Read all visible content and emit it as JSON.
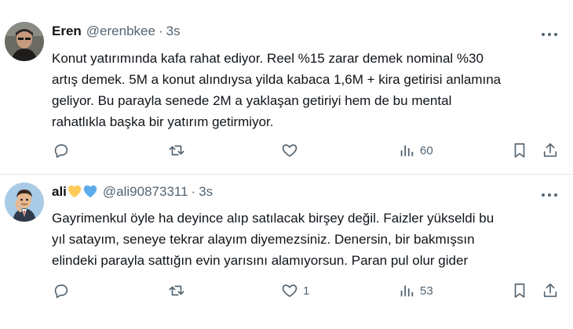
{
  "tweets": [
    {
      "name": "Eren",
      "handle": "@erenbkee",
      "separator": "·",
      "time": "3s",
      "text": "Konut yatırımında kafa rahat ediyor. Reel %15 zarar demek nominal %30\nartış demek. 5M a konut alındıysa yilda kabaca 1,6M + kira getirisi anlamına\ngeliyor. Bu parayla senede 2M a yaklaşan getiriyi hem de bu mental\nrahatlıkla başka bir yatırım getirmiyor.",
      "reply_count": "",
      "retweet_count": "",
      "like_count": "",
      "view_count": "60"
    },
    {
      "name": "ali",
      "handle": "@ali90873311",
      "separator": "·",
      "time": "3s",
      "name_emojis": [
        "yellow-heart-icon",
        "blue-heart-icon"
      ],
      "text": "Gayrimenkul öyle ha deyince alıp satılacak birşey değil. Faizler yükseldi bu\nyıl satayım, seneye tekrar alayım diyemezsiniz. Denersin, bir bakmışsın\nelindeki parayla sattığın evin yarısını alamıyorsun. Paran pul olur gider",
      "reply_count": "",
      "retweet_count": "",
      "like_count": "1",
      "view_count": "53"
    }
  ],
  "colors": {
    "text": "#0f1419",
    "secondary": "#536471",
    "divider": "#e1e6ea",
    "yellow_heart": "#fdcb58",
    "blue_heart": "#5dadec"
  }
}
